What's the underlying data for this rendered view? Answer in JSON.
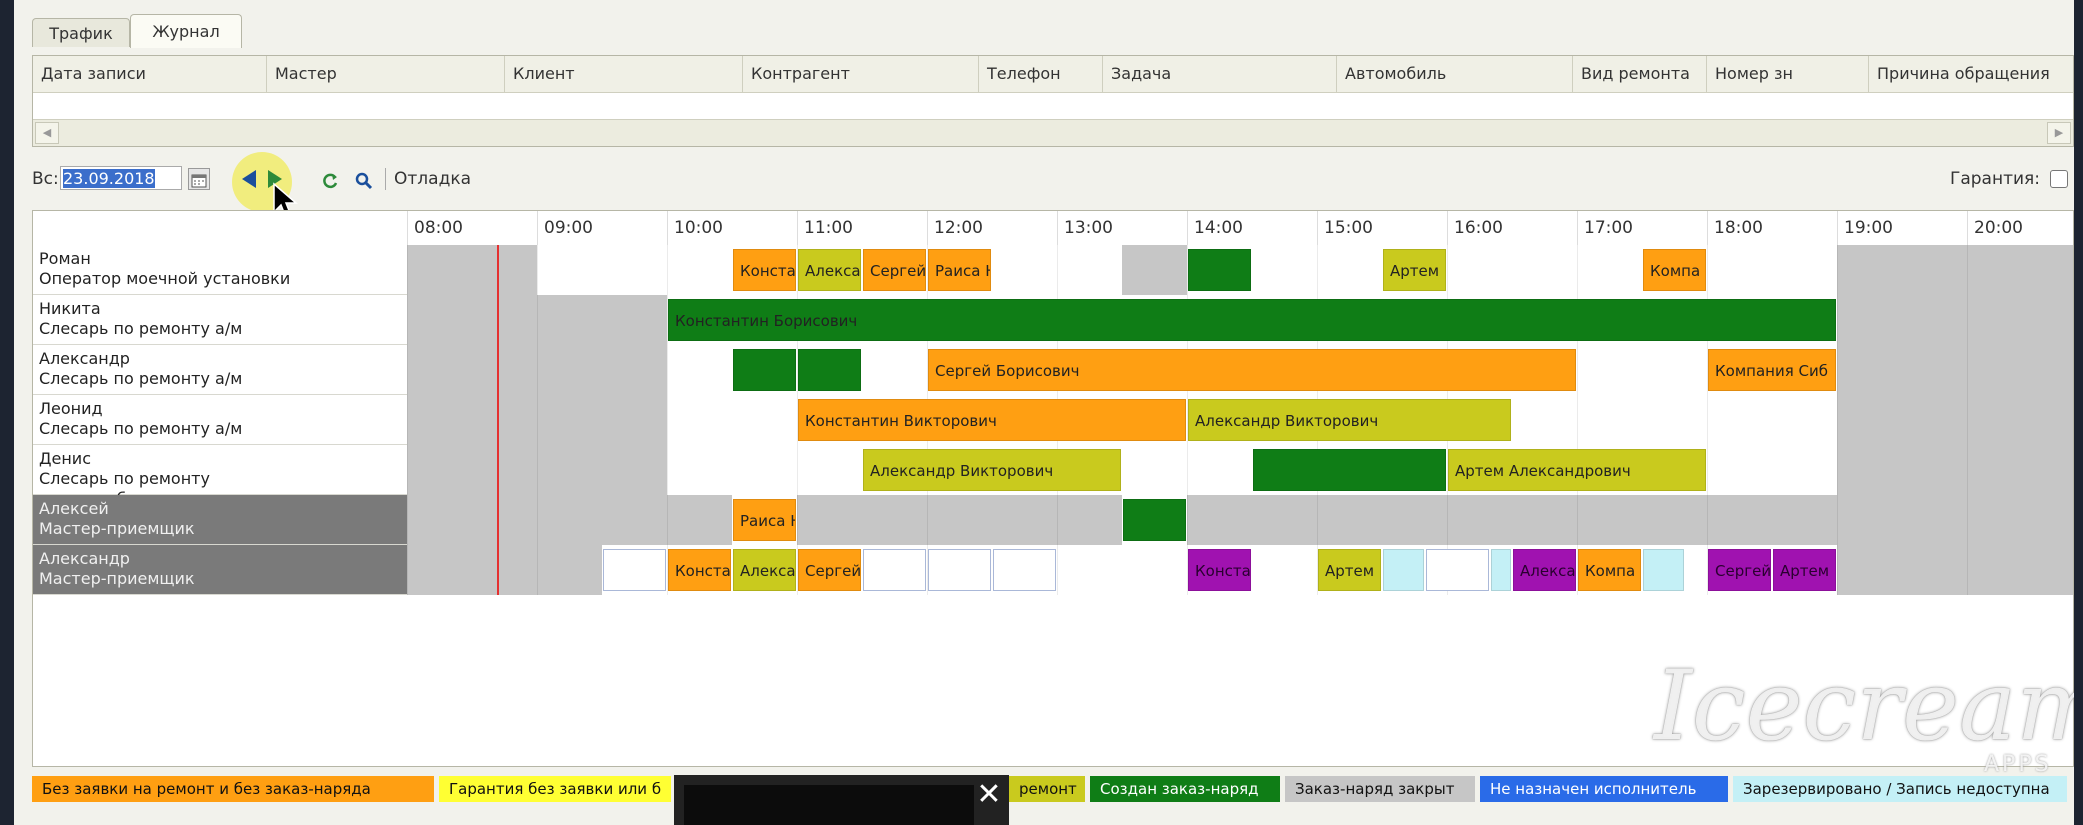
{
  "tabs": [
    "Трафик",
    "Журнал"
  ],
  "grid": {
    "columns": [
      "Дата записи",
      "Мастер",
      "Клиент",
      "Контрагент",
      "Телефон",
      "Задача",
      "Автомобиль",
      "Вид ремонта",
      "Номер зн",
      "Причина обращения"
    ]
  },
  "toolbar": {
    "day_label": "Вс:",
    "date_value": "23.09.2018",
    "calendar_icon": "calendar-icon",
    "prev_icon": "arrow-left-icon",
    "next_icon": "arrow-right-icon",
    "refresh_icon": "refresh-icon",
    "search_icon": "search-icon",
    "debug_label": "Отладка",
    "guarantee_label": "Гарантия:"
  },
  "timeline": {
    "hours": [
      "08:00",
      "09:00",
      "10:00",
      "11:00",
      "12:00",
      "13:00",
      "14:00",
      "15:00",
      "16:00",
      "17:00",
      "18:00",
      "19:00",
      "20:00"
    ]
  },
  "staff": [
    {
      "name": "Роман",
      "role": "Оператор моечной установки",
      "dark": false
    },
    {
      "name": "Никита",
      "role": "Слесарь по ремонту а/м",
      "dark": false
    },
    {
      "name": "Александр",
      "role": "Слесарь по ремонту а/м",
      "dark": false
    },
    {
      "name": "Леонид",
      "role": "Слесарь по ремонту а/м",
      "dark": false
    },
    {
      "name": "Денис",
      "role": "Слесарь по ремонту электрооборудования",
      "dark": false
    },
    {
      "name": "Алексей",
      "role": "Мастер-приемщик",
      "dark": true
    },
    {
      "name": "Александр",
      "role": "Мастер-приемщик",
      "dark": true
    }
  ],
  "colors": {
    "orange": "#ff9f12",
    "olive": "#c9ca1e",
    "green": "#0f7d16",
    "grey": "#c6c6c6",
    "purple": "#a012b0",
    "blue": "#2a6be8",
    "cyan": "#c4f0f6",
    "white": "#ffffff"
  },
  "events": [
    {
      "row": 0,
      "start": "10:30",
      "end": "11:00",
      "color": "orange",
      "label": "Конста"
    },
    {
      "row": 0,
      "start": "11:00",
      "end": "11:30",
      "color": "olive",
      "label": "Алекса"
    },
    {
      "row": 0,
      "start": "11:30",
      "end": "12:00",
      "color": "orange",
      "label": "Сергей"
    },
    {
      "row": 0,
      "start": "12:00",
      "end": "12:30",
      "color": "orange",
      "label": "Раиса Н"
    },
    {
      "row": 0,
      "start": "14:00",
      "end": "14:30",
      "color": "green",
      "label": ""
    },
    {
      "row": 0,
      "start": "15:30",
      "end": "16:00",
      "color": "olive",
      "label": "Артем"
    },
    {
      "row": 0,
      "start": "17:30",
      "end": "18:00",
      "color": "orange",
      "label": "Компа"
    },
    {
      "row": 1,
      "start": "10:00",
      "end": "19:00",
      "color": "green",
      "label": "Константин Борисович"
    },
    {
      "row": 2,
      "start": "10:30",
      "end": "11:00",
      "color": "green",
      "label": ""
    },
    {
      "row": 2,
      "start": "11:00",
      "end": "11:30",
      "color": "green",
      "label": ""
    },
    {
      "row": 2,
      "start": "12:00",
      "end": "17:00",
      "color": "orange",
      "label": "Сергей Борисович"
    },
    {
      "row": 2,
      "start": "18:00",
      "end": "19:00",
      "color": "orange",
      "label": "Компания Сиб"
    },
    {
      "row": 3,
      "start": "11:00",
      "end": "14:00",
      "color": "orange",
      "label": "Константин Викторович"
    },
    {
      "row": 3,
      "start": "14:00",
      "end": "16:30",
      "color": "olive",
      "label": "Александр Викторович"
    },
    {
      "row": 4,
      "start": "11:30",
      "end": "13:30",
      "color": "olive",
      "label": "Александр Викторович"
    },
    {
      "row": 4,
      "start": "14:30",
      "end": "16:00",
      "color": "green",
      "label": ""
    },
    {
      "row": 4,
      "start": "16:00",
      "end": "18:00",
      "color": "olive",
      "label": "Артем Александрович"
    },
    {
      "row": 5,
      "start": "10:30",
      "end": "11:00",
      "color": "orange",
      "label": "Раиса Н"
    },
    {
      "row": 5,
      "start": "13:30",
      "end": "14:00",
      "color": "green",
      "label": ""
    },
    {
      "row": 6,
      "start": "09:30",
      "end": "10:00",
      "color": "white",
      "label": ""
    },
    {
      "row": 6,
      "start": "10:00",
      "end": "10:30",
      "color": "orange",
      "label": "Конста"
    },
    {
      "row": 6,
      "start": "10:30",
      "end": "11:00",
      "color": "olive",
      "label": "Алекса"
    },
    {
      "row": 6,
      "start": "11:00",
      "end": "11:30",
      "color": "orange",
      "label": "Сергей"
    },
    {
      "row": 6,
      "start": "11:30",
      "end": "12:00",
      "color": "white",
      "label": ""
    },
    {
      "row": 6,
      "start": "12:00",
      "end": "12:30",
      "color": "white",
      "label": ""
    },
    {
      "row": 6,
      "start": "12:30",
      "end": "13:00",
      "color": "white",
      "label": ""
    },
    {
      "row": 6,
      "start": "14:00",
      "end": "14:30",
      "color": "purple",
      "label": "Конста"
    },
    {
      "row": 6,
      "start": "15:00",
      "end": "15:30",
      "color": "olive",
      "label": "Артем"
    },
    {
      "row": 6,
      "start": "15:30",
      "end": "15:50",
      "color": "cyan",
      "label": ""
    },
    {
      "row": 6,
      "start": "15:50",
      "end": "16:20",
      "color": "white",
      "label": ""
    },
    {
      "row": 6,
      "start": "16:20",
      "end": "16:30",
      "color": "cyan",
      "label": ""
    },
    {
      "row": 6,
      "start": "16:30",
      "end": "17:00",
      "color": "purple",
      "label": "Алекса"
    },
    {
      "row": 6,
      "start": "17:00",
      "end": "17:30",
      "color": "orange",
      "label": "Компа"
    },
    {
      "row": 6,
      "start": "17:30",
      "end": "17:50",
      "color": "cyan",
      "label": ""
    },
    {
      "row": 6,
      "start": "18:00",
      "end": "18:30",
      "color": "purple",
      "label": "Сергей"
    },
    {
      "row": 6,
      "start": "18:30",
      "end": "19:00",
      "color": "purple",
      "label": "Артем"
    }
  ],
  "legend": [
    {
      "label": "Без заявки на ремонт и без заказ-наряда",
      "color": "orange"
    },
    {
      "label": "Гарантия без заявки или б",
      "color": "yellow"
    },
    {
      "label": "ремонт",
      "color": "olive"
    },
    {
      "label": "Создан заказ-наряд",
      "color": "green"
    },
    {
      "label": "Заказ-наряд закрыт",
      "color": "grey"
    },
    {
      "label": "Не назначен исполнитель",
      "color": "blue"
    },
    {
      "label": "Зарезервировано / Запись недоступна",
      "color": "cyan"
    }
  ],
  "popup": {
    "close_icon": "close-icon",
    "close_glyph": "✕"
  },
  "watermark": {
    "text": "Icecream",
    "sub": "APPS"
  }
}
